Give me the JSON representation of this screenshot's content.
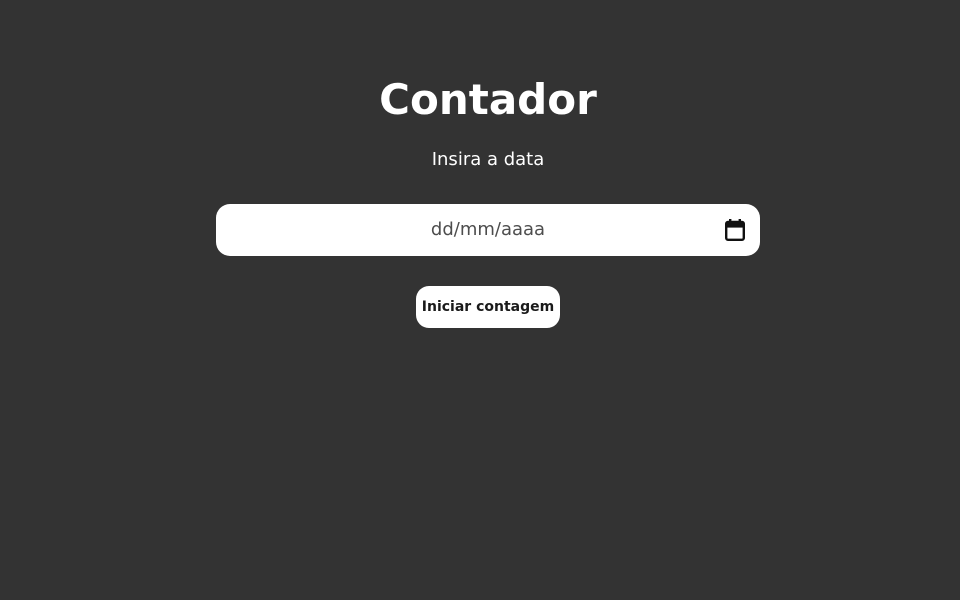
{
  "page": {
    "title": "Contador",
    "subtitle": "Insira a data"
  },
  "date_input": {
    "placeholder": "dd/mm/aaaa",
    "icon": "calendar-icon"
  },
  "start_button": {
    "label": "Iniciar contagem"
  },
  "colors": {
    "background": "#333333",
    "text": "#ffffff",
    "field_background": "#ffffff",
    "placeholder_text": "#4d4d4d",
    "button_text": "#1a1a1a"
  }
}
